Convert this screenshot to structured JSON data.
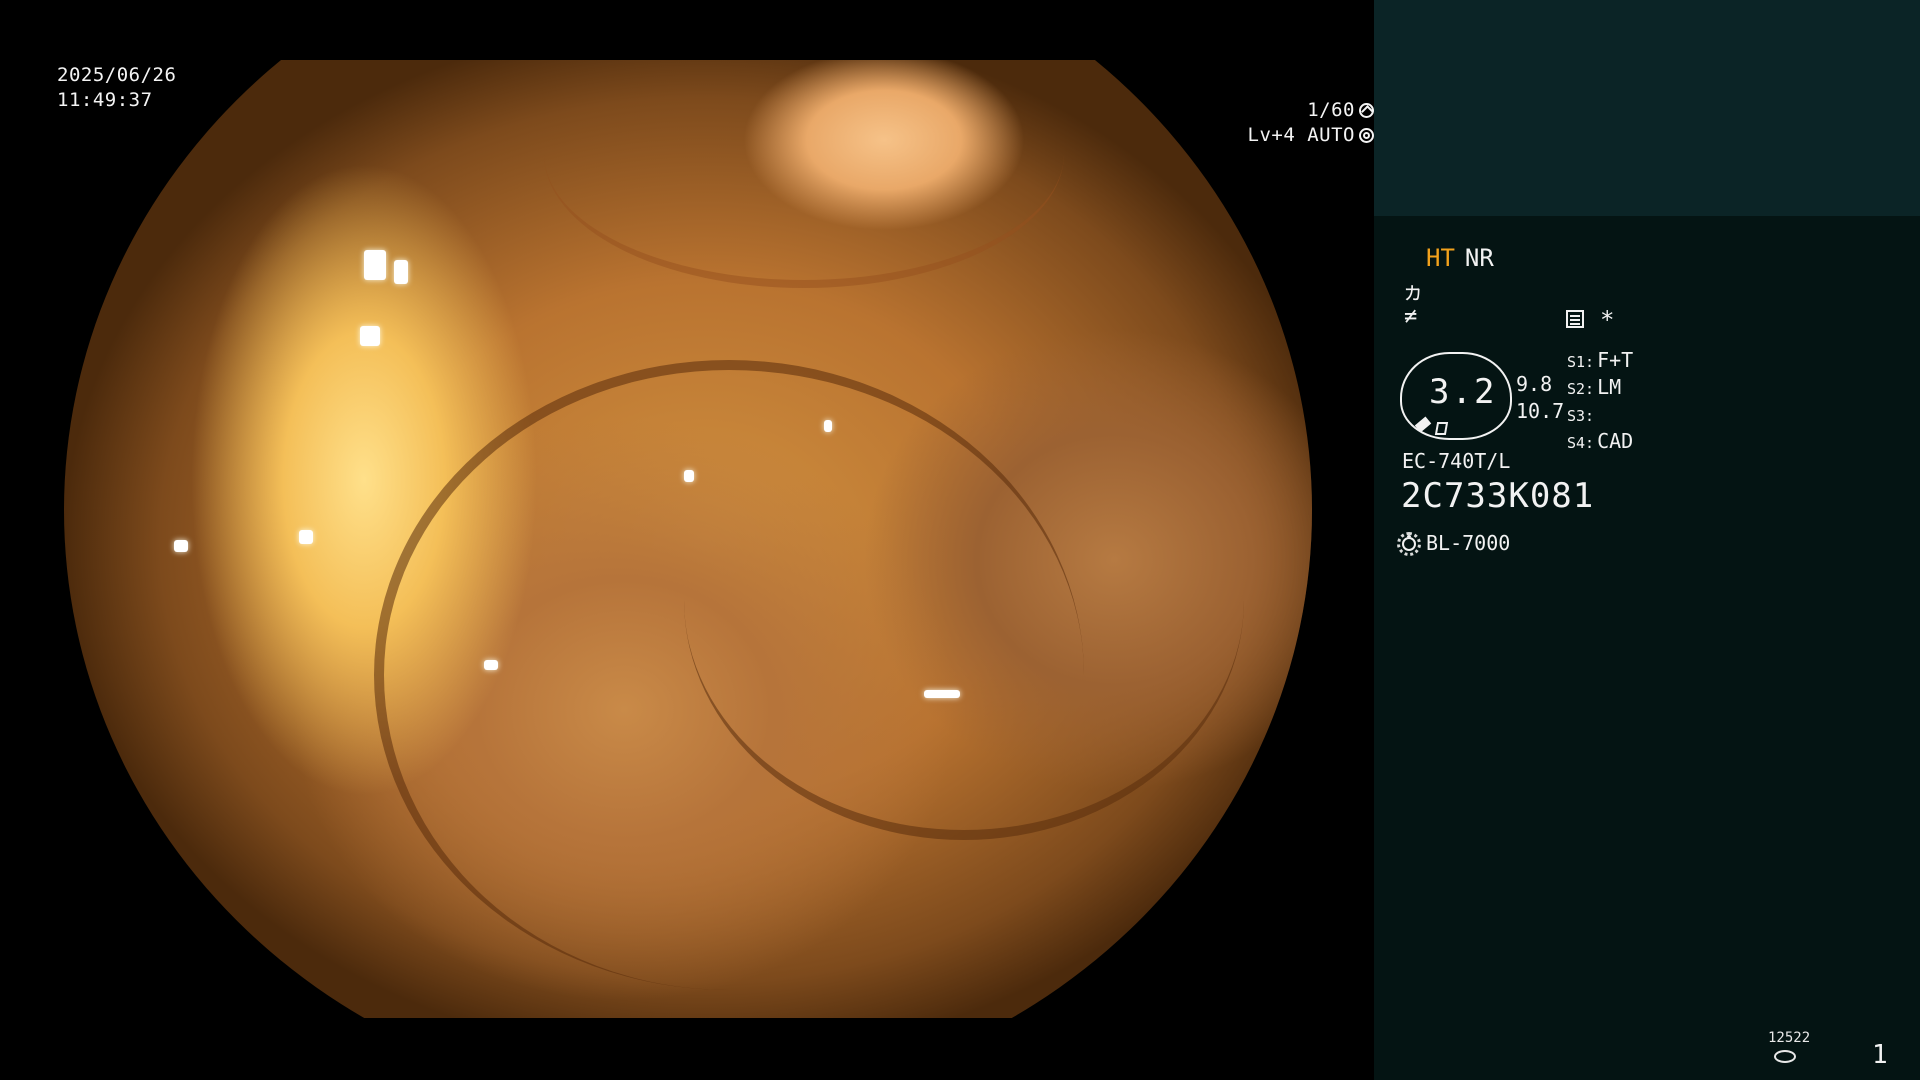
{
  "osd": {
    "date": "2025/06/26",
    "time": "11:49:37",
    "shutter": "1/60",
    "level_mode": "Lv+4 AUTO"
  },
  "panel": {
    "ht_label": "HT",
    "nr_label": "NR",
    "asterisk": "*",
    "zoom_value": "3.2",
    "zoom_num1": "9.8",
    "zoom_num2": "10.7",
    "switches": [
      {
        "key": "S1:",
        "value": "F+T"
      },
      {
        "key": "S2:",
        "value": "LM"
      },
      {
        "key": "S3:",
        "value": ""
      },
      {
        "key": "S4:",
        "value": "CAD"
      }
    ],
    "scope_model": "EC-740T/L",
    "scope_serial": "2C733K081",
    "light_source": "BL-7000",
    "image_count": "12522",
    "page_number": "1"
  },
  "icons": [
    "shutter-icon",
    "iris-icon",
    "enhance-icon",
    "structure-icon",
    "menu-icon",
    "zoom-scope-icon",
    "light-icon",
    "disk-icon"
  ],
  "colors": {
    "panel_bg": "#041413",
    "panel_top_bg": "#0b2426",
    "ht_accent": "#f3a21c",
    "osd_text": "#f4f4f4"
  }
}
